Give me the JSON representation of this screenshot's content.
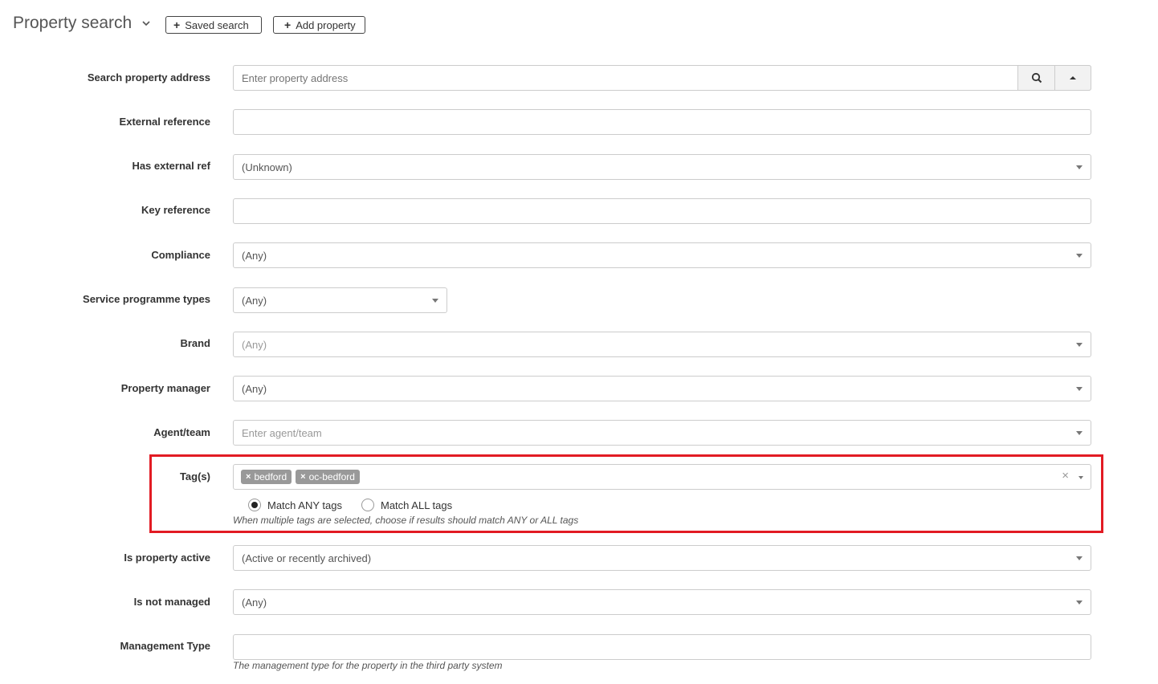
{
  "header": {
    "title": "Property search",
    "saved_search_label": "Saved search",
    "add_property_label": "Add property"
  },
  "form": {
    "address": {
      "label": "Search property address",
      "placeholder": "Enter property address"
    },
    "external_reference": {
      "label": "External reference",
      "value": ""
    },
    "has_external_ref": {
      "label": "Has external ref",
      "value": "(Unknown)"
    },
    "key_reference": {
      "label": "Key reference",
      "value": ""
    },
    "compliance": {
      "label": "Compliance",
      "value": "(Any)"
    },
    "service_programme_types": {
      "label": "Service programme types",
      "value": "(Any)"
    },
    "brand": {
      "label": "Brand",
      "value": "(Any)"
    },
    "property_manager": {
      "label": "Property manager",
      "value": "(Any)"
    },
    "agent_team": {
      "label": "Agent/team",
      "placeholder": "Enter agent/team"
    },
    "tags": {
      "label": "Tag(s)",
      "selected": [
        "bedford",
        "oc-bedford"
      ],
      "match_any_label": "Match ANY tags",
      "match_all_label": "Match ALL tags",
      "selected_match": "any",
      "help": "When multiple tags are selected, choose if results should match ANY or ALL tags"
    },
    "is_property_active": {
      "label": "Is property active",
      "value": "(Active or recently archived)"
    },
    "is_not_managed": {
      "label": "Is not managed",
      "value": "(Any)"
    },
    "management_type": {
      "label": "Management Type",
      "value": "",
      "help": "The management type for the property in the third party system"
    }
  },
  "colors": {
    "highlight": "#e21b23",
    "tag_bg": "#999999"
  }
}
